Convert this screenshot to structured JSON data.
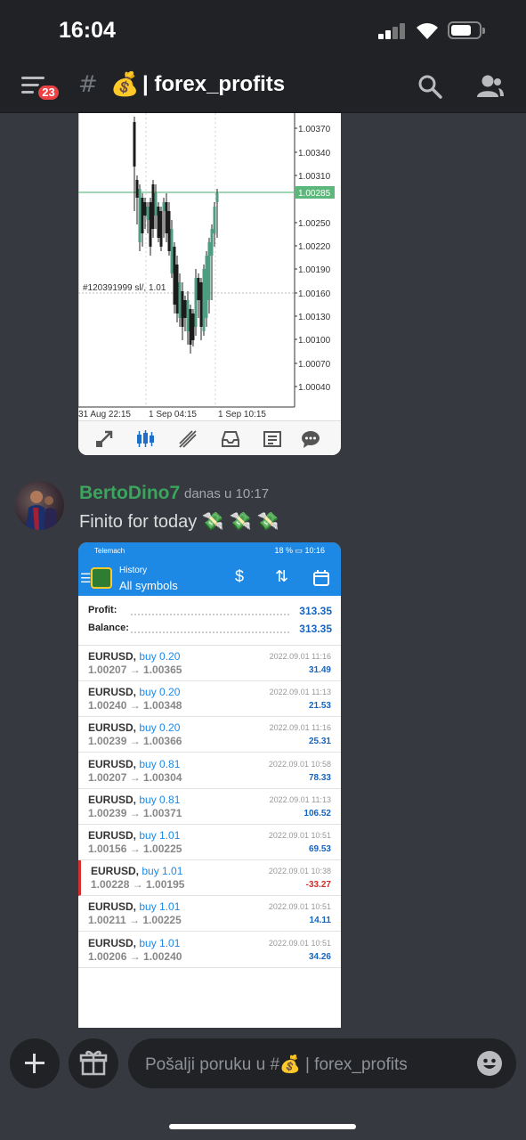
{
  "status_bar": {
    "time": "16:04",
    "battery_level": 0.72
  },
  "header": {
    "badge_count": "23",
    "channel_hash": "#",
    "channel_emoji": "💰",
    "channel_name": "| forex_profits"
  },
  "chart_image": {
    "price_labels": [
      "1.00370",
      "1.00340",
      "1.00310",
      "1.00250",
      "1.00220",
      "1.00190",
      "1.00160",
      "1.00130",
      "1.00100",
      "1.00070",
      "1.00040"
    ],
    "current_price": "1.00285",
    "order_label": "#120391999 sl/, 1.01",
    "time_labels": [
      "31 Aug 22:15",
      "1 Sep 04:15",
      "1 Sep 10:15"
    ],
    "toolbar_icons": [
      "trade-icon",
      "chart-type-icon",
      "objects-icon",
      "inbox-icon",
      "news-icon",
      "chat-icon"
    ]
  },
  "message": {
    "author": "BertoDino7",
    "timestamp": "danas u 10:17",
    "text": "Finito for today",
    "emojis": "💸💸💸"
  },
  "history": {
    "status_left": "Telemach",
    "status_right": "18 % ▭ 10:16",
    "title_small": "History",
    "title_big": "All symbols",
    "profit_label": "Profit:",
    "profit_value": "313.35",
    "balance_label": "Balance:",
    "balance_value": "313.35",
    "trades": [
      {
        "symbol": "EURUSD,",
        "side": "buy 0.20",
        "prices": "1.00207 → 1.00365",
        "time": "2022.09.01 11:16",
        "pnl": "31.49"
      },
      {
        "symbol": "EURUSD,",
        "side": "buy 0.20",
        "prices": "1.00240 → 1.00348",
        "time": "2022.09.01 11:13",
        "pnl": "21.53"
      },
      {
        "symbol": "EURUSD,",
        "side": "buy 0.20",
        "prices": "1.00239 → 1.00366",
        "time": "2022.09.01 11:16",
        "pnl": "25.31"
      },
      {
        "symbol": "EURUSD,",
        "side": "buy 0.81",
        "prices": "1.00207 → 1.00304",
        "time": "2022.09.01 10:58",
        "pnl": "78.33"
      },
      {
        "symbol": "EURUSD,",
        "side": "buy 0.81",
        "prices": "1.00239 → 1.00371",
        "time": "2022.09.01 11:13",
        "pnl": "106.52"
      },
      {
        "symbol": "EURUSD,",
        "side": "buy 1.01",
        "prices": "1.00156 → 1.00225",
        "time": "2022.09.01 10:51",
        "pnl": "69.53"
      },
      {
        "symbol": "EURUSD,",
        "side": "buy 1.01",
        "prices": "1.00228 → 1.00195",
        "time": "2022.09.01 10:38",
        "pnl": "-33.27"
      },
      {
        "symbol": "EURUSD,",
        "side": "buy 1.01",
        "prices": "1.00211 → 1.00225",
        "time": "2022.09.01 10:51",
        "pnl": "14.11"
      },
      {
        "symbol": "EURUSD,",
        "side": "buy 1.01",
        "prices": "1.00206 → 1.00240",
        "time": "2022.09.01 10:51",
        "pnl": "34.26"
      }
    ]
  },
  "composer": {
    "placeholder": "Pošalji poruku u #💰 | forex_profits"
  },
  "colors": {
    "background": "#36393f",
    "header": "#202225",
    "author": "#3ba55d",
    "badge": "#ed4245",
    "mt_blue": "#1e88e5"
  }
}
